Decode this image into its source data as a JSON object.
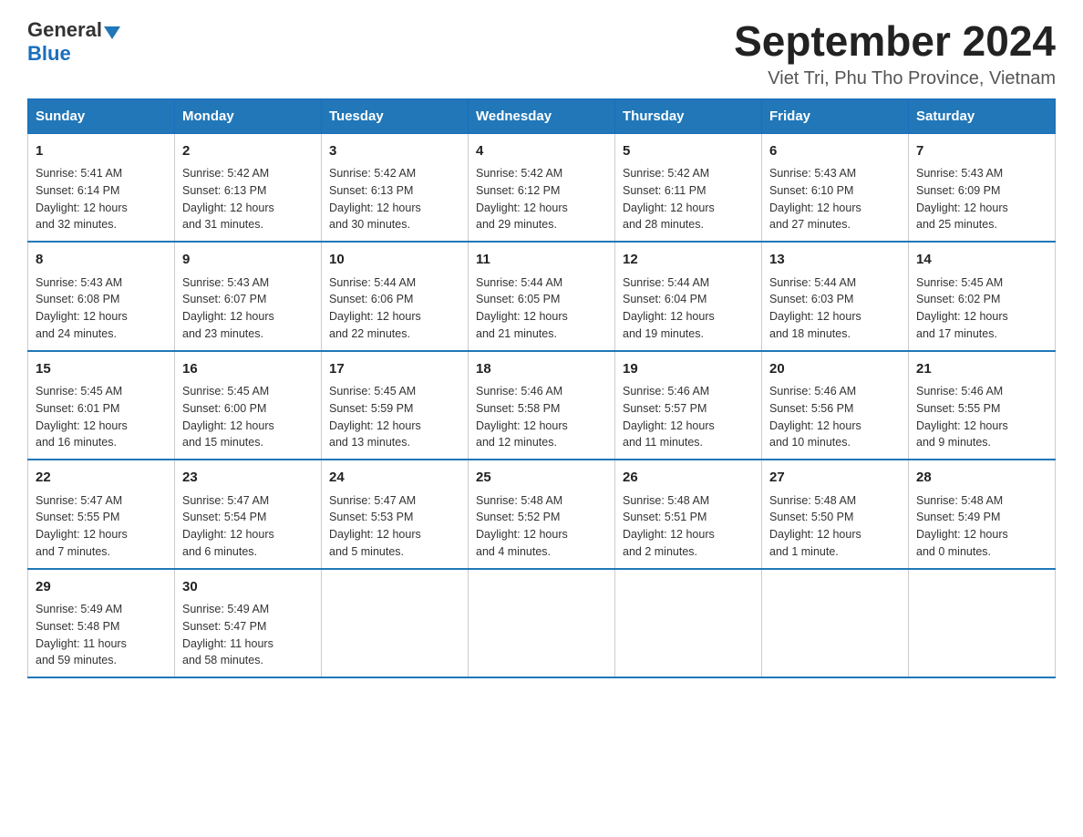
{
  "header": {
    "logo_general": "General",
    "logo_blue": "Blue",
    "month_year": "September 2024",
    "location": "Viet Tri, Phu Tho Province, Vietnam"
  },
  "columns": [
    "Sunday",
    "Monday",
    "Tuesday",
    "Wednesday",
    "Thursday",
    "Friday",
    "Saturday"
  ],
  "weeks": [
    [
      {
        "day": "1",
        "sunrise": "5:41 AM",
        "sunset": "6:14 PM",
        "daylight": "12 hours and 32 minutes."
      },
      {
        "day": "2",
        "sunrise": "5:42 AM",
        "sunset": "6:13 PM",
        "daylight": "12 hours and 31 minutes."
      },
      {
        "day": "3",
        "sunrise": "5:42 AM",
        "sunset": "6:13 PM",
        "daylight": "12 hours and 30 minutes."
      },
      {
        "day": "4",
        "sunrise": "5:42 AM",
        "sunset": "6:12 PM",
        "daylight": "12 hours and 29 minutes."
      },
      {
        "day": "5",
        "sunrise": "5:42 AM",
        "sunset": "6:11 PM",
        "daylight": "12 hours and 28 minutes."
      },
      {
        "day": "6",
        "sunrise": "5:43 AM",
        "sunset": "6:10 PM",
        "daylight": "12 hours and 27 minutes."
      },
      {
        "day": "7",
        "sunrise": "5:43 AM",
        "sunset": "6:09 PM",
        "daylight": "12 hours and 25 minutes."
      }
    ],
    [
      {
        "day": "8",
        "sunrise": "5:43 AM",
        "sunset": "6:08 PM",
        "daylight": "12 hours and 24 minutes."
      },
      {
        "day": "9",
        "sunrise": "5:43 AM",
        "sunset": "6:07 PM",
        "daylight": "12 hours and 23 minutes."
      },
      {
        "day": "10",
        "sunrise": "5:44 AM",
        "sunset": "6:06 PM",
        "daylight": "12 hours and 22 minutes."
      },
      {
        "day": "11",
        "sunrise": "5:44 AM",
        "sunset": "6:05 PM",
        "daylight": "12 hours and 21 minutes."
      },
      {
        "day": "12",
        "sunrise": "5:44 AM",
        "sunset": "6:04 PM",
        "daylight": "12 hours and 19 minutes."
      },
      {
        "day": "13",
        "sunrise": "5:44 AM",
        "sunset": "6:03 PM",
        "daylight": "12 hours and 18 minutes."
      },
      {
        "day": "14",
        "sunrise": "5:45 AM",
        "sunset": "6:02 PM",
        "daylight": "12 hours and 17 minutes."
      }
    ],
    [
      {
        "day": "15",
        "sunrise": "5:45 AM",
        "sunset": "6:01 PM",
        "daylight": "12 hours and 16 minutes."
      },
      {
        "day": "16",
        "sunrise": "5:45 AM",
        "sunset": "6:00 PM",
        "daylight": "12 hours and 15 minutes."
      },
      {
        "day": "17",
        "sunrise": "5:45 AM",
        "sunset": "5:59 PM",
        "daylight": "12 hours and 13 minutes."
      },
      {
        "day": "18",
        "sunrise": "5:46 AM",
        "sunset": "5:58 PM",
        "daylight": "12 hours and 12 minutes."
      },
      {
        "day": "19",
        "sunrise": "5:46 AM",
        "sunset": "5:57 PM",
        "daylight": "12 hours and 11 minutes."
      },
      {
        "day": "20",
        "sunrise": "5:46 AM",
        "sunset": "5:56 PM",
        "daylight": "12 hours and 10 minutes."
      },
      {
        "day": "21",
        "sunrise": "5:46 AM",
        "sunset": "5:55 PM",
        "daylight": "12 hours and 9 minutes."
      }
    ],
    [
      {
        "day": "22",
        "sunrise": "5:47 AM",
        "sunset": "5:55 PM",
        "daylight": "12 hours and 7 minutes."
      },
      {
        "day": "23",
        "sunrise": "5:47 AM",
        "sunset": "5:54 PM",
        "daylight": "12 hours and 6 minutes."
      },
      {
        "day": "24",
        "sunrise": "5:47 AM",
        "sunset": "5:53 PM",
        "daylight": "12 hours and 5 minutes."
      },
      {
        "day": "25",
        "sunrise": "5:48 AM",
        "sunset": "5:52 PM",
        "daylight": "12 hours and 4 minutes."
      },
      {
        "day": "26",
        "sunrise": "5:48 AM",
        "sunset": "5:51 PM",
        "daylight": "12 hours and 2 minutes."
      },
      {
        "day": "27",
        "sunrise": "5:48 AM",
        "sunset": "5:50 PM",
        "daylight": "12 hours and 1 minute."
      },
      {
        "day": "28",
        "sunrise": "5:48 AM",
        "sunset": "5:49 PM",
        "daylight": "12 hours and 0 minutes."
      }
    ],
    [
      {
        "day": "29",
        "sunrise": "5:49 AM",
        "sunset": "5:48 PM",
        "daylight": "11 hours and 59 minutes."
      },
      {
        "day": "30",
        "sunrise": "5:49 AM",
        "sunset": "5:47 PM",
        "daylight": "11 hours and 58 minutes."
      },
      null,
      null,
      null,
      null,
      null
    ]
  ]
}
